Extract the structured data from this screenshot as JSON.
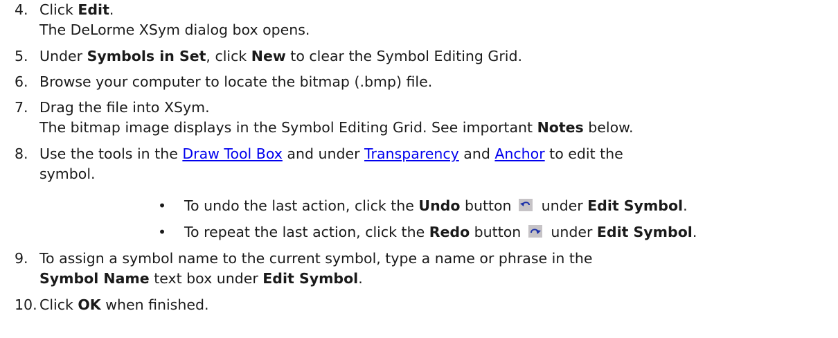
{
  "steps": [
    {
      "num": "4.",
      "line1": {
        "t1": "Click ",
        "b1": "Edit",
        "t2": "."
      },
      "line2": "The DeLorme XSym dialog box opens."
    },
    {
      "num": "5.",
      "line1": {
        "t1": "Under ",
        "b1": "Symbols in Set",
        "t2": ", click ",
        "b2": "New",
        "t3": " to clear the Symbol Editing Grid."
      }
    },
    {
      "num": "6.",
      "line1": {
        "t1": "Browse your computer to locate the bitmap (.bmp) file."
      }
    },
    {
      "num": "7.",
      "line1": {
        "t1": "Drag the file into XSym."
      },
      "line2": {
        "t1": "The bitmap image displays in the Symbol Editing Grid. See important ",
        "b1": "Notes",
        "t2": " below."
      }
    },
    {
      "num": "8.",
      "line1": {
        "t1": "Use the tools in the ",
        "link1": "Draw Tool Box",
        "t2": " and under ",
        "link2": "Transparency",
        "t3": " and ",
        "link3": "Anchor",
        "t4": " to edit the"
      },
      "line2": "symbol."
    },
    {
      "num": "9.",
      "line1": {
        "t1": "To assign a symbol name to the current symbol, type a name or phrase in the"
      },
      "line2": {
        "b1": "Symbol Name",
        "t1": " text box under ",
        "b2": "Edit Symbol",
        "t2": "."
      }
    },
    {
      "num": "10.",
      "line1": {
        "t1": "Click ",
        "b1": "OK",
        "t2": " when finished."
      }
    }
  ],
  "bullets": [
    {
      "t1": "To undo the last action, click the ",
      "b1": "Undo",
      "t2": " button ",
      "icon": "undo-icon",
      "t3": " under ",
      "b2": "Edit Symbol",
      "t4": "."
    },
    {
      "t1": "To repeat the last action, click the ",
      "b1": "Redo",
      "t2": " button ",
      "icon": "redo-icon",
      "t3": " under ",
      "b2": "Edit Symbol",
      "t4": "."
    }
  ],
  "bullet_char": "•",
  "colors": {
    "link": "#0000ee",
    "text": "#1a1a1a",
    "icon_bg": "#c6c3c6",
    "icon_arrow": "#1a2fa8"
  }
}
